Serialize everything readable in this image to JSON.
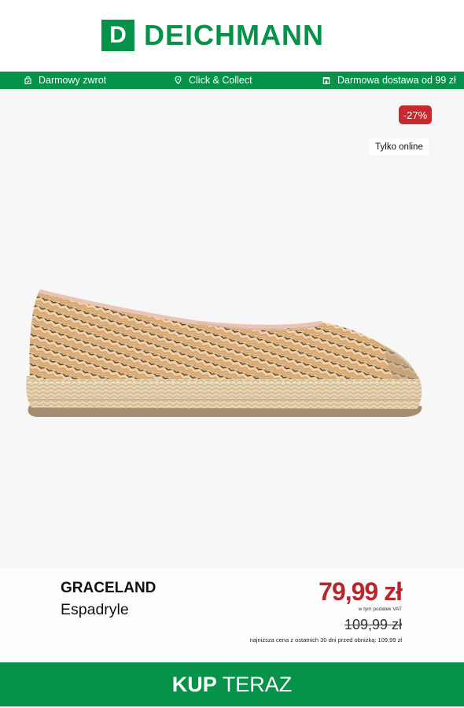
{
  "brand_logo": {
    "letter": "D",
    "name": "DEICHMANN",
    "color": "#07924a"
  },
  "usp_bar": {
    "items": [
      {
        "icon": "bag-return-icon",
        "label": "Darmowy zwrot"
      },
      {
        "icon": "location-pin-icon",
        "label": "Click & Collect"
      },
      {
        "icon": "store-icon",
        "label": "Darmowa dostawa od 99 zł"
      }
    ]
  },
  "product": {
    "discount_badge": "-27%",
    "online_badge": "Tylko online",
    "brand": "GRACELAND",
    "type": "Espadryle",
    "price": "79,99 zł",
    "vat_note": "w tym podatek VAT",
    "old_price": "109,99 zł",
    "lowest_price_note": "najniższa cena z ostatnich 30 dni przed obniżką: 109,99 zł",
    "price_color": "#b8262d"
  },
  "cta": {
    "bold": "KUP",
    "regular": " TERAZ"
  }
}
